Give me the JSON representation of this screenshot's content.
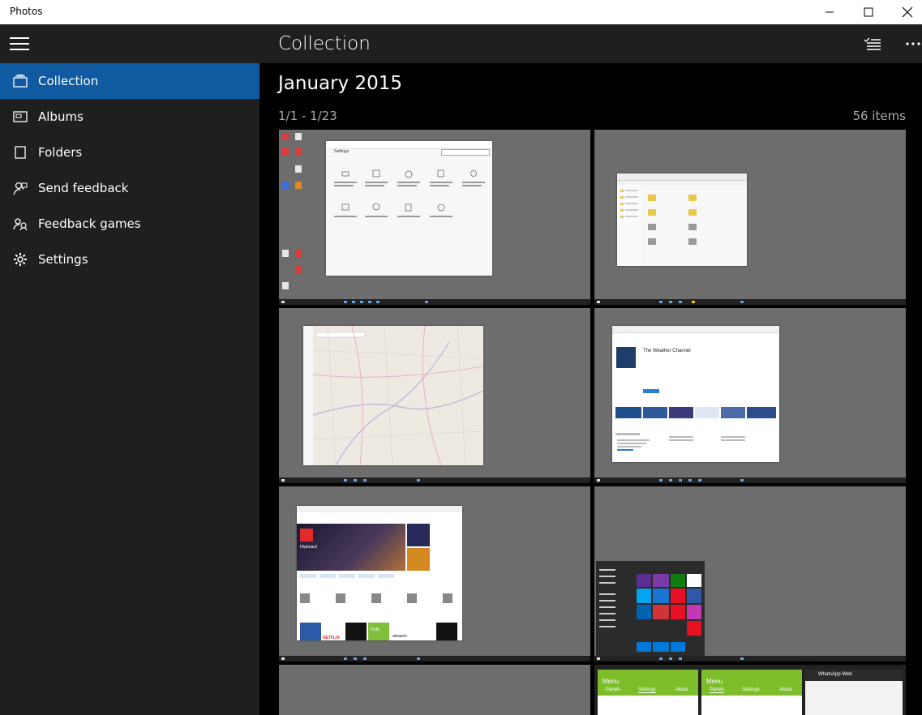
{
  "titlebar": {
    "title": "Photos"
  },
  "sidebar": {
    "items": [
      {
        "label": "Collection",
        "icon": "collection-icon",
        "active": true
      },
      {
        "label": "Albums",
        "icon": "album-icon",
        "active": false
      },
      {
        "label": "Folders",
        "icon": "folder-icon",
        "active": false
      },
      {
        "label": "Send feedback",
        "icon": "feedback-icon",
        "active": false
      },
      {
        "label": "Feedback games",
        "icon": "feedback-games-icon",
        "active": false
      },
      {
        "label": "Settings",
        "icon": "gear-icon",
        "active": false
      }
    ]
  },
  "header": {
    "title": "Collection"
  },
  "group": {
    "month": "January 2015",
    "range": "1/1 - 1/23",
    "count": "56 items"
  },
  "colors": {
    "accent": "#0f5aa0",
    "sidebar_bg": "#1f1f1f",
    "content_bg": "#000000",
    "thumb_bg": "#6d6d6d"
  },
  "thumbnails": [
    "Settings window screenshot",
    "File Explorer screenshot",
    "Maps screenshot",
    "Store app page screenshot",
    "Store home screenshot",
    "Start menu screenshot",
    "Desktop screenshot",
    "Phone screenshots"
  ],
  "thumb_text": {
    "settings_title": "Settings",
    "weather_title": "The Weather Channel",
    "store_flipboard": "Flipboard",
    "apps_netflix": "NETFLIX",
    "apps_hulu": "hulu",
    "apps_amazon": "amazon",
    "phone_menu": "Menu",
    "phone_panels": "Panels",
    "phone_settings": "Settings",
    "phone_about": "About",
    "whatsapp": "WhatsApp Web"
  }
}
